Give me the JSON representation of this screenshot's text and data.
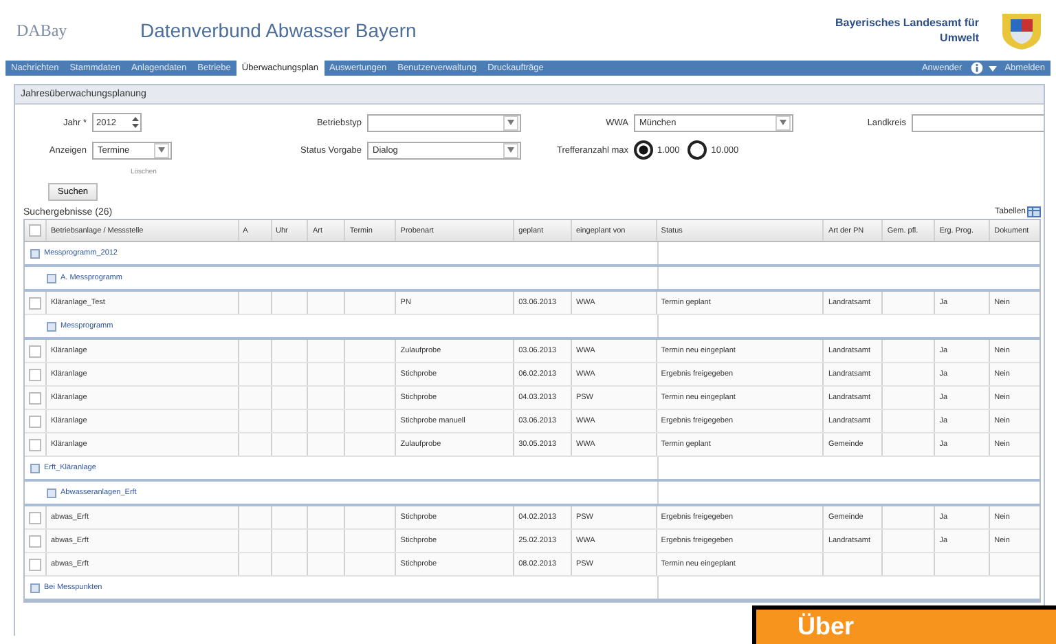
{
  "header": {
    "logo": "DABay",
    "title": "Datenverbund Abwasser Bayern",
    "agency": "Bayerisches Landesamt für Umwelt"
  },
  "nav": {
    "items": [
      {
        "label": "Nachrichten",
        "selected": false
      },
      {
        "label": "Stammdaten",
        "selected": false
      },
      {
        "label": "Anlagendaten",
        "selected": false
      },
      {
        "label": "Betriebe",
        "selected": false
      },
      {
        "label": "Überwachungsplan",
        "selected": true
      },
      {
        "label": "Auswertungen",
        "selected": false
      },
      {
        "label": "Benutzerverwaltung",
        "selected": false
      },
      {
        "label": "Druckaufträge",
        "selected": false
      }
    ],
    "user": "Anwender",
    "logout": "Abmelden"
  },
  "panel": {
    "title": "Jahresüberwachungsplanung",
    "fields": [
      {
        "label": "Jahr *",
        "value": "2012",
        "kind": "spinner"
      },
      {
        "label": "Betriebstyp",
        "kind": "select"
      },
      {
        "label": "WWA",
        "value": "München",
        "kind": "select"
      },
      {
        "label": "Landkreis",
        "kind": "select"
      },
      {
        "label": "Anzeigen",
        "value": "Termine",
        "kind": "select"
      },
      {
        "label": "Status Vorgabe",
        "value": "Dialog",
        "kind": "select"
      },
      {
        "label": "Trefferanzahl max",
        "kind": "radio",
        "options": [
          {
            "label": "1.000",
            "selected": true
          },
          {
            "label": "10.000",
            "selected": false
          }
        ]
      }
    ],
    "hint": "Löschen",
    "search_button": "Suchen"
  },
  "results": {
    "title": "Suchergebnisse (26)",
    "tables_link": "Tabellen",
    "all_checked": false,
    "columns": [
      "Betriebsanlage / Messstelle",
      "A",
      "Uhr",
      "Art",
      "Termin",
      "Probenart",
      "geplant",
      "eingeplant von",
      "Status",
      "Art der PN",
      "Gem. pfl.",
      "Erg. Prog.",
      "Dokument"
    ],
    "groups": [
      {
        "label": "Messprogramm_2012",
        "children": [
          {
            "label": "A. Messprogramm",
            "rows": [
              {
                "checked": false,
                "cells": [
                  "Kläranlage_Test",
                  "",
                  "",
                  "",
                  "",
                  "PN",
                  "03.06.2013",
                  "WWA",
                  "Termin geplant",
                  "Landratsamt",
                  "",
                  "Ja",
                  "Nein"
                ]
              }
            ]
          },
          {
            "label": "Messprogramm",
            "rows": [
              {
                "checked": false,
                "cells": [
                  "Kläranlage",
                  "",
                  "",
                  "",
                  "",
                  "Zulaufprobe",
                  "03.06.2013",
                  "WWA",
                  "Termin neu eingeplant",
                  "Landratsamt",
                  "",
                  "Ja",
                  "Nein"
                ]
              },
              {
                "checked": false,
                "cells": [
                  "Kläranlage",
                  "",
                  "",
                  "",
                  "",
                  "Stichprobe",
                  "06.02.2013",
                  "WWA",
                  "Ergebnis freigegeben",
                  "Landratsamt",
                  "",
                  "Ja",
                  "Nein"
                ]
              },
              {
                "checked": false,
                "cells": [
                  "Kläranlage",
                  "",
                  "",
                  "",
                  "",
                  "Stichprobe",
                  "04.03.2013",
                  "PSW",
                  "Termin neu eingeplant",
                  "Landratsamt",
                  "",
                  "Ja",
                  "Nein"
                ]
              },
              {
                "checked": false,
                "cells": [
                  "Kläranlage",
                  "",
                  "",
                  "",
                  "",
                  "Stichprobe manuell",
                  "03.06.2013",
                  "WWA",
                  "Ergebnis freigegeben",
                  "Landratsamt",
                  "",
                  "Ja",
                  "Nein"
                ]
              },
              {
                "checked": false,
                "cells": [
                  "Kläranlage",
                  "",
                  "",
                  "",
                  "",
                  "Zulaufprobe",
                  "30.05.2013",
                  "WWA",
                  "Termin geplant",
                  "Gemeinde",
                  "",
                  "Ja",
                  "Nein"
                ]
              }
            ]
          }
        ]
      },
      {
        "label": "Erft_Kläranlage",
        "children": [
          {
            "label": "Abwasseranlagen_Erft",
            "rows": [
              {
                "checked": false,
                "cells": [
                  "abwas_Erft",
                  "",
                  "",
                  "",
                  "",
                  "Stichprobe",
                  "04.02.2013",
                  "PSW",
                  "Ergebnis freigegeben",
                  "Gemeinde",
                  "",
                  "Ja",
                  "Nein"
                ]
              },
              {
                "checked": false,
                "cells": [
                  "abwas_Erft",
                  "",
                  "",
                  "",
                  "",
                  "Stichprobe",
                  "25.02.2013",
                  "WWA",
                  "Ergebnis freigegeben",
                  "Landratsamt",
                  "",
                  "Ja",
                  "Nein"
                ]
              },
              {
                "checked": false,
                "cells": [
                  "abwas_Erft",
                  "",
                  "",
                  "",
                  "",
                  "Stichprobe",
                  "08.02.2013",
                  "PSW",
                  "Termin neu eingeplant",
                  "",
                  "",
                  "",
                  ""
                ]
              }
            ]
          }
        ]
      },
      {
        "label": "Bei Messpunkten"
      }
    ]
  },
  "overlay": {
    "text": "Über"
  }
}
